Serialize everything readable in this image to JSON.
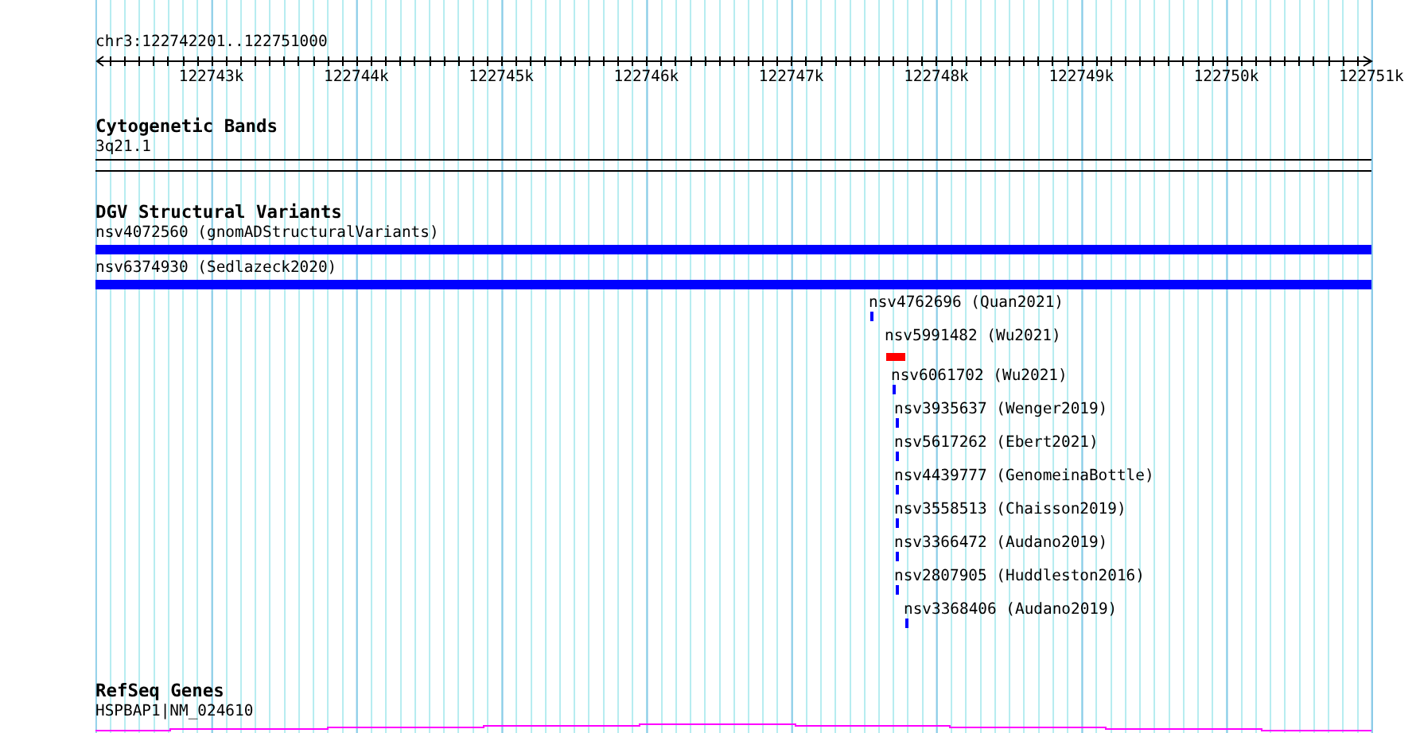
{
  "ruler": {
    "title": "chr3:122742201..122751000",
    "ticks": [
      "122743k",
      "122744k",
      "122745k",
      "122746k",
      "122747k",
      "122748k",
      "122749k",
      "122750k",
      "122751k"
    ]
  },
  "tracks": [
    {
      "kind": "cytoband",
      "title": "Cytogenetic Bands",
      "features": [
        {
          "label": "3q21.1"
        }
      ]
    },
    {
      "kind": "variants",
      "title": "DGV Structural Variants",
      "features": [
        {
          "label": "nsv4072560 (gnomADStructuralVariants)",
          "color": "#0000ff"
        },
        {
          "label": "nsv6374930 (Sedlazeck2020)",
          "color": "#0000ff"
        },
        {
          "label": "nsv4762696 (Quan2021)",
          "color": "#0000ff"
        },
        {
          "label": "nsv5991482 (Wu2021)",
          "color": "#ff0000"
        },
        {
          "label": "nsv6061702 (Wu2021)",
          "color": "#0000ff"
        },
        {
          "label": "nsv3935637 (Wenger2019)",
          "color": "#0000ff"
        },
        {
          "label": "nsv5617262 (Ebert2021)",
          "color": "#0000ff"
        },
        {
          "label": "nsv4439777 (GenomeinaBottle)",
          "color": "#0000ff"
        },
        {
          "label": "nsv3558513 (Chaisson2019)",
          "color": "#0000ff"
        },
        {
          "label": "nsv3366472 (Audano2019)",
          "color": "#0000ff"
        },
        {
          "label": "nsv2807905 (Huddleston2016)",
          "color": "#0000ff"
        },
        {
          "label": "nsv3368406 (Audano2019)",
          "color": "#0000ff"
        }
      ]
    },
    {
      "kind": "gene",
      "title": "RefSeq Genes",
      "features": [
        {
          "label": "HSPBAP1|NM_024610"
        }
      ]
    }
  ]
}
